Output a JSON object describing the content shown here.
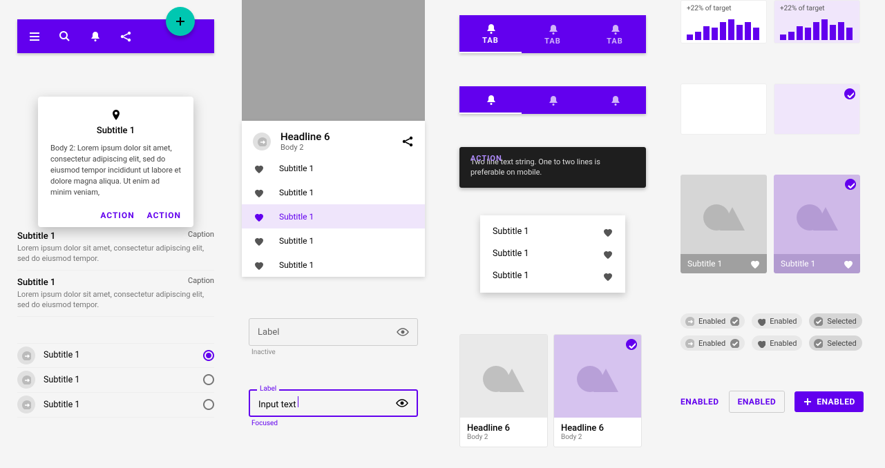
{
  "colors": {
    "primary": "#6200ee",
    "accent": "#00c7b1"
  },
  "appbar": {
    "icons": [
      "menu",
      "search",
      "bell",
      "share"
    ]
  },
  "fab": {
    "icon": "plus"
  },
  "card": {
    "icon": "location",
    "subtitle": "Subtitle 1",
    "body": "Body 2: Lorem ipsum dolor sit amet, consectetur adipiscing elit, sed do eiusmod tempor incididunt ut labore et dolore magna aliqua. Ut enim ad minim veniam,",
    "action1": "ACTION",
    "action2": "ACTION"
  },
  "text_list": [
    {
      "title": "Subtitle 1",
      "caption": "Caption",
      "body": "Lorem ipsum dolor sit amet, consectetur adipiscing elit, sed do eiusmod tempor."
    },
    {
      "title": "Subtitle 1",
      "caption": "Caption",
      "body": "Lorem ipsum dolor sit amet, consectetur adipiscing elit, sed do eiusmod tempor."
    }
  ],
  "radio_list": [
    {
      "label": "Subtitle 1",
      "selected": true
    },
    {
      "label": "Subtitle 1",
      "selected": false
    },
    {
      "label": "Subtitle 1",
      "selected": false
    }
  ],
  "panel": {
    "headline": "Headline 6",
    "body": "Body 2",
    "items": [
      {
        "label": "Subtitle 1",
        "selected": false
      },
      {
        "label": "Subtitle 1",
        "selected": false
      },
      {
        "label": "Subtitle 1",
        "selected": true
      },
      {
        "label": "Subtitle 1",
        "selected": false
      },
      {
        "label": "Subtitle 1",
        "selected": false
      }
    ]
  },
  "tf1": {
    "label": "Label",
    "helper": "Inactive"
  },
  "tf2": {
    "label": "Label",
    "value": "Input text",
    "helper": "Focused"
  },
  "tabs_label": "TAB",
  "snackbar": {
    "text": "Two line text string. One to two lines is preferable on mobile.",
    "action": "ACTION"
  },
  "menu3": [
    "Subtitle 1",
    "Subtitle 1",
    "Subtitle 1"
  ],
  "img_cards": [
    {
      "headline": "Headline 6",
      "body": "Body 2",
      "selected": false
    },
    {
      "headline": "Headline 6",
      "body": "Body 2",
      "selected": true
    }
  ],
  "stats": {
    "label": "+22% of target"
  },
  "chart_data": [
    {
      "type": "bar",
      "title": "+22% of target",
      "values": [
        8,
        12,
        20,
        18,
        26,
        30,
        22,
        26,
        18
      ]
    },
    {
      "type": "bar",
      "title": "+22% of target",
      "values": [
        8,
        12,
        20,
        18,
        26,
        30,
        22,
        26,
        18
      ]
    }
  ],
  "img_tiles": {
    "label": "Subtitle 1"
  },
  "chips": [
    [
      {
        "label": "Enabled",
        "icon": "arrow",
        "close": true
      },
      {
        "label": "Enabled",
        "icon": "heart"
      },
      {
        "label": "Selected",
        "icon": "check",
        "selected": true
      }
    ],
    [
      {
        "label": "Enabled",
        "icon": "arrow",
        "close": true
      },
      {
        "label": "Enabled",
        "icon": "heart"
      },
      {
        "label": "Selected",
        "icon": "check",
        "selected": true
      }
    ]
  ],
  "buttons": {
    "text": "ENABLED",
    "outlined": "ENABLED",
    "contained": "ENABLED"
  }
}
